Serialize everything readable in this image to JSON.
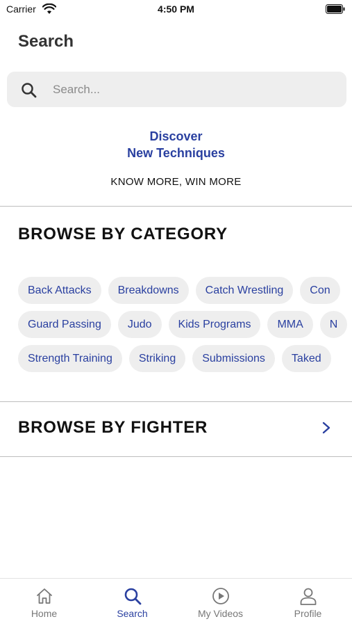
{
  "status_bar": {
    "carrier": "Carrier",
    "time": "4:50 PM"
  },
  "header": {
    "title": "Search"
  },
  "search": {
    "placeholder": "Search..."
  },
  "promo": {
    "line1": "Discover",
    "line2": "New Techniques",
    "tagline": "KNOW MORE, WIN MORE"
  },
  "browse_category": {
    "heading": "BROWSE BY CATEGORY",
    "rows": [
      [
        "Back Attacks",
        "Breakdowns",
        "Catch Wrestling",
        "Con"
      ],
      [
        "Guard Passing",
        "Judo",
        "Kids Programs",
        "MMA",
        "N"
      ],
      [
        "Strength Training",
        "Striking",
        "Submissions",
        "Taked"
      ]
    ]
  },
  "browse_fighter": {
    "heading": "BROWSE BY FIGHTER"
  },
  "tab_bar": {
    "tabs": [
      {
        "label": "Home",
        "icon": "home-icon",
        "active": false
      },
      {
        "label": "Search",
        "icon": "search-icon",
        "active": true
      },
      {
        "label": "My Videos",
        "icon": "play-circle-icon",
        "active": false
      },
      {
        "label": "Profile",
        "icon": "user-icon",
        "active": false
      }
    ]
  },
  "colors": {
    "accent": "#2a40a0",
    "chip_bg": "#eeeeee",
    "search_bg": "#eeeeee",
    "inactive_tab": "#777777"
  }
}
